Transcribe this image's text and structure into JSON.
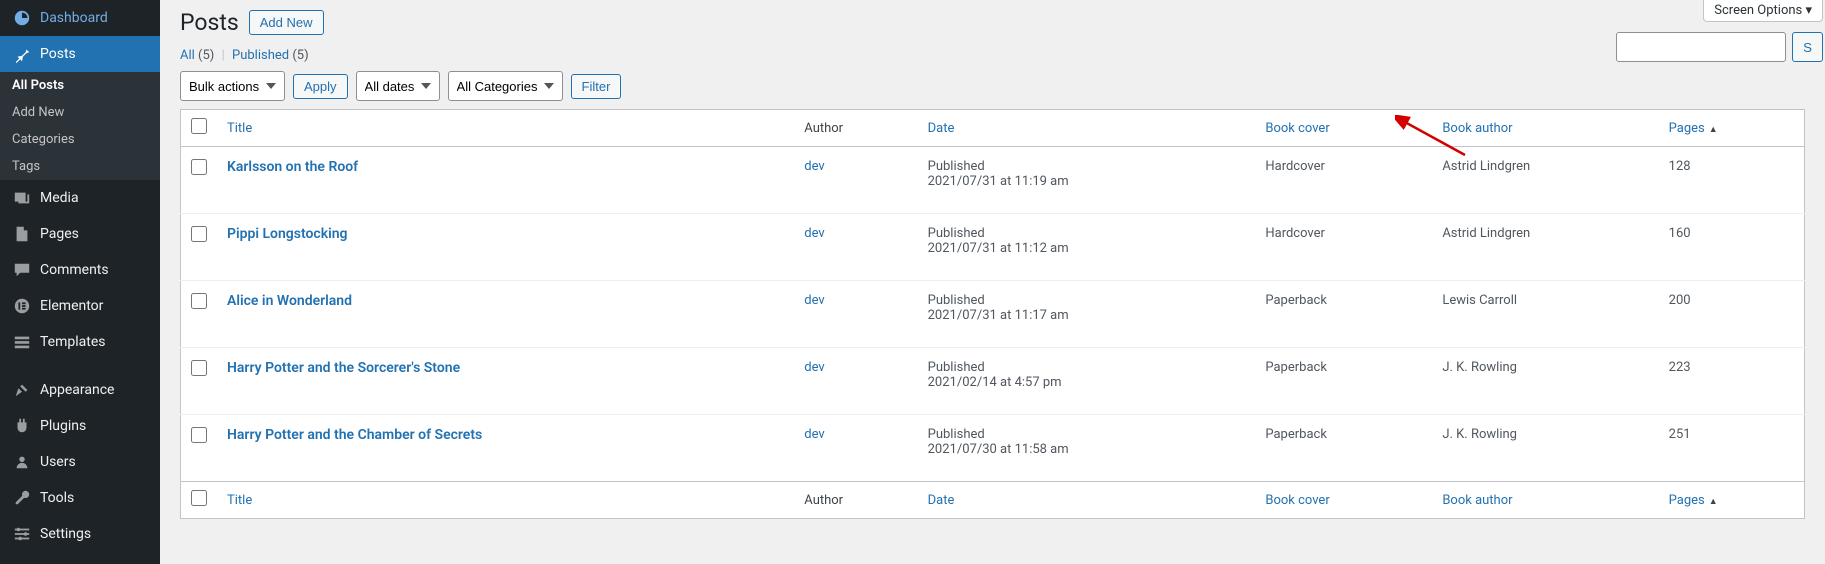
{
  "screen_options": "Screen Options ▾",
  "sidebar": {
    "dashboard": "Dashboard",
    "posts": "Posts",
    "submenu": {
      "all": "All Posts",
      "add": "Add New",
      "cats": "Categories",
      "tags": "Tags"
    },
    "media": "Media",
    "pages": "Pages",
    "comments": "Comments",
    "elementor": "Elementor",
    "templates": "Templates",
    "appearance": "Appearance",
    "plugins": "Plugins",
    "users": "Users",
    "tools": "Tools",
    "settings": "Settings"
  },
  "page": {
    "title": "Posts",
    "add_new": "Add New"
  },
  "subsubsub": {
    "all_label": "All",
    "all_count": "(5)",
    "published_label": "Published",
    "published_count": "(5)"
  },
  "filters": {
    "bulk": "Bulk actions",
    "apply": "Apply",
    "dates": "All dates",
    "cats": "All Categories",
    "filter": "Filter"
  },
  "search": {
    "placeholder": "",
    "button": "S"
  },
  "columns": {
    "title": "Title",
    "author": "Author",
    "date": "Date",
    "book_cover": "Book cover",
    "book_author": "Book author",
    "pages": "Pages"
  },
  "rows": [
    {
      "title": "Karlsson on the Roof",
      "author": "dev",
      "status": "Published",
      "date": "2021/07/31 at 11:19 am",
      "cover": "Hardcover",
      "book_author": "Astrid Lindgren",
      "pages": "128"
    },
    {
      "title": "Pippi Longstocking",
      "author": "dev",
      "status": "Published",
      "date": "2021/07/31 at 11:12 am",
      "cover": "Hardcover",
      "book_author": "Astrid Lindgren",
      "pages": "160"
    },
    {
      "title": "Alice in Wonderland",
      "author": "dev",
      "status": "Published",
      "date": "2021/07/31 at 11:17 am",
      "cover": "Paperback",
      "book_author": "Lewis Carroll",
      "pages": "200"
    },
    {
      "title": "Harry Potter and the Sorcerer's Stone",
      "author": "dev",
      "status": "Published",
      "date": "2021/02/14 at 4:57 pm",
      "cover": "Paperback",
      "book_author": "J. K. Rowling",
      "pages": "223"
    },
    {
      "title": "Harry Potter and the Chamber of Secrets",
      "author": "dev",
      "status": "Published",
      "date": "2021/07/30 at 11:58 am",
      "cover": "Paperback",
      "book_author": "J. K. Rowling",
      "pages": "251"
    }
  ]
}
